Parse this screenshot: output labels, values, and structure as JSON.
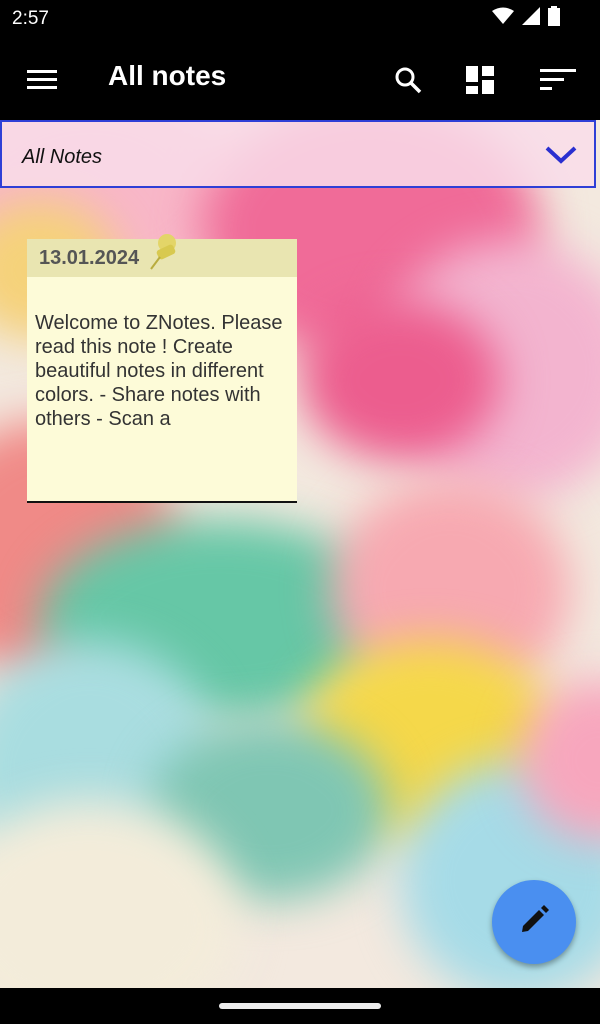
{
  "status_bar": {
    "time": "2:57"
  },
  "app_bar": {
    "title": "All notes",
    "icons": [
      "menu-icon",
      "search-icon",
      "dashboard-icon",
      "sort-icon"
    ]
  },
  "filter": {
    "selected": "All Notes"
  },
  "notes": [
    {
      "date": "13.01.2024",
      "text": "Welcome to ZNotes. Please read this note ! Create beautiful notes in different colors. - Share notes with others - Scan a"
    }
  ],
  "fab": {
    "icon": "pencil-icon"
  },
  "colors": {
    "app_bar": "#000000",
    "dropdown_border": "#2f3fd6",
    "note_bg": "#fdfbd8",
    "note_header": "#e9e5b1",
    "fab": "#4a8ff0"
  }
}
